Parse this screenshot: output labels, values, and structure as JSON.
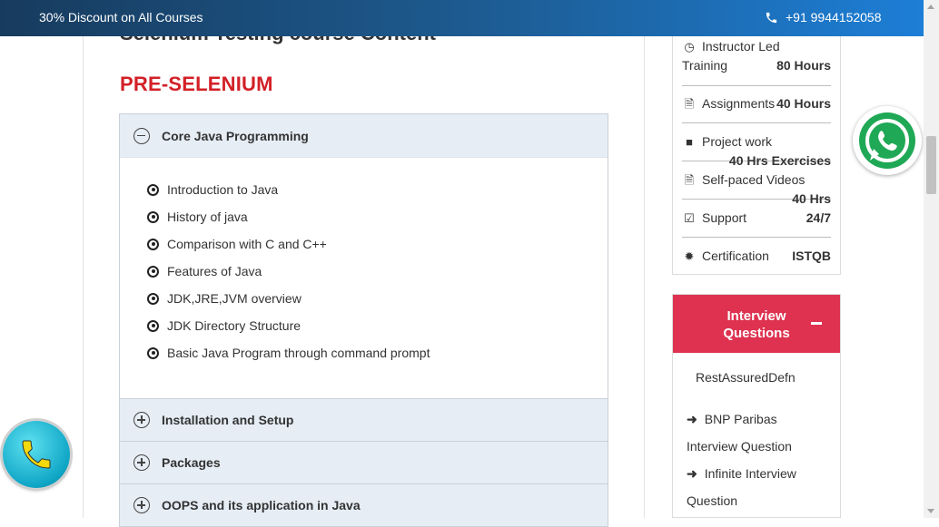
{
  "topbar": {
    "promo": "30% Discount on All Courses",
    "phone": "+91 9944152058"
  },
  "course": {
    "heading": "Selenium Testing course Content",
    "section_title": "PRE-SELENIUM",
    "accordion": [
      {
        "label": "Core Java Programming",
        "expanded": true,
        "items": [
          "Introduction to Java",
          "History of java",
          "Comparison with C and C++",
          "Features of Java",
          "JDK,JRE,JVM overview",
          "JDK Directory Structure",
          "Basic Java Program through command prompt"
        ]
      },
      {
        "label": "Installation and Setup",
        "expanded": false
      },
      {
        "label": "Packages",
        "expanded": false
      },
      {
        "label": "OOPS and its application in Java",
        "expanded": false
      }
    ]
  },
  "details": {
    "instructor_label_1": "Instructor Led",
    "instructor_label_2": "Training",
    "instructor_value": "80 Hours",
    "assignments_label": "Assignments",
    "assignments_value": "40 Hours",
    "project_label": "Project work",
    "project_value": "40 Hrs Exercises",
    "selfpaced_label": "Self-paced Videos",
    "selfpaced_value": "40 Hrs",
    "support_label": "Support",
    "support_value": "24/7",
    "cert_label": "Certification",
    "cert_value": "ISTQB"
  },
  "interview": {
    "title_line1": "Interview",
    "title_line2": "Questions",
    "link1": "RestAssuredDefn",
    "link2": "BNP Paribas",
    "link2b": "Interview Question",
    "link3": "Infinite Interview",
    "link3b": "Question"
  },
  "colors": {
    "accent_red": "#d32027",
    "interview_header": "#de3250",
    "accordion_head_bg": "#e6edf5"
  }
}
